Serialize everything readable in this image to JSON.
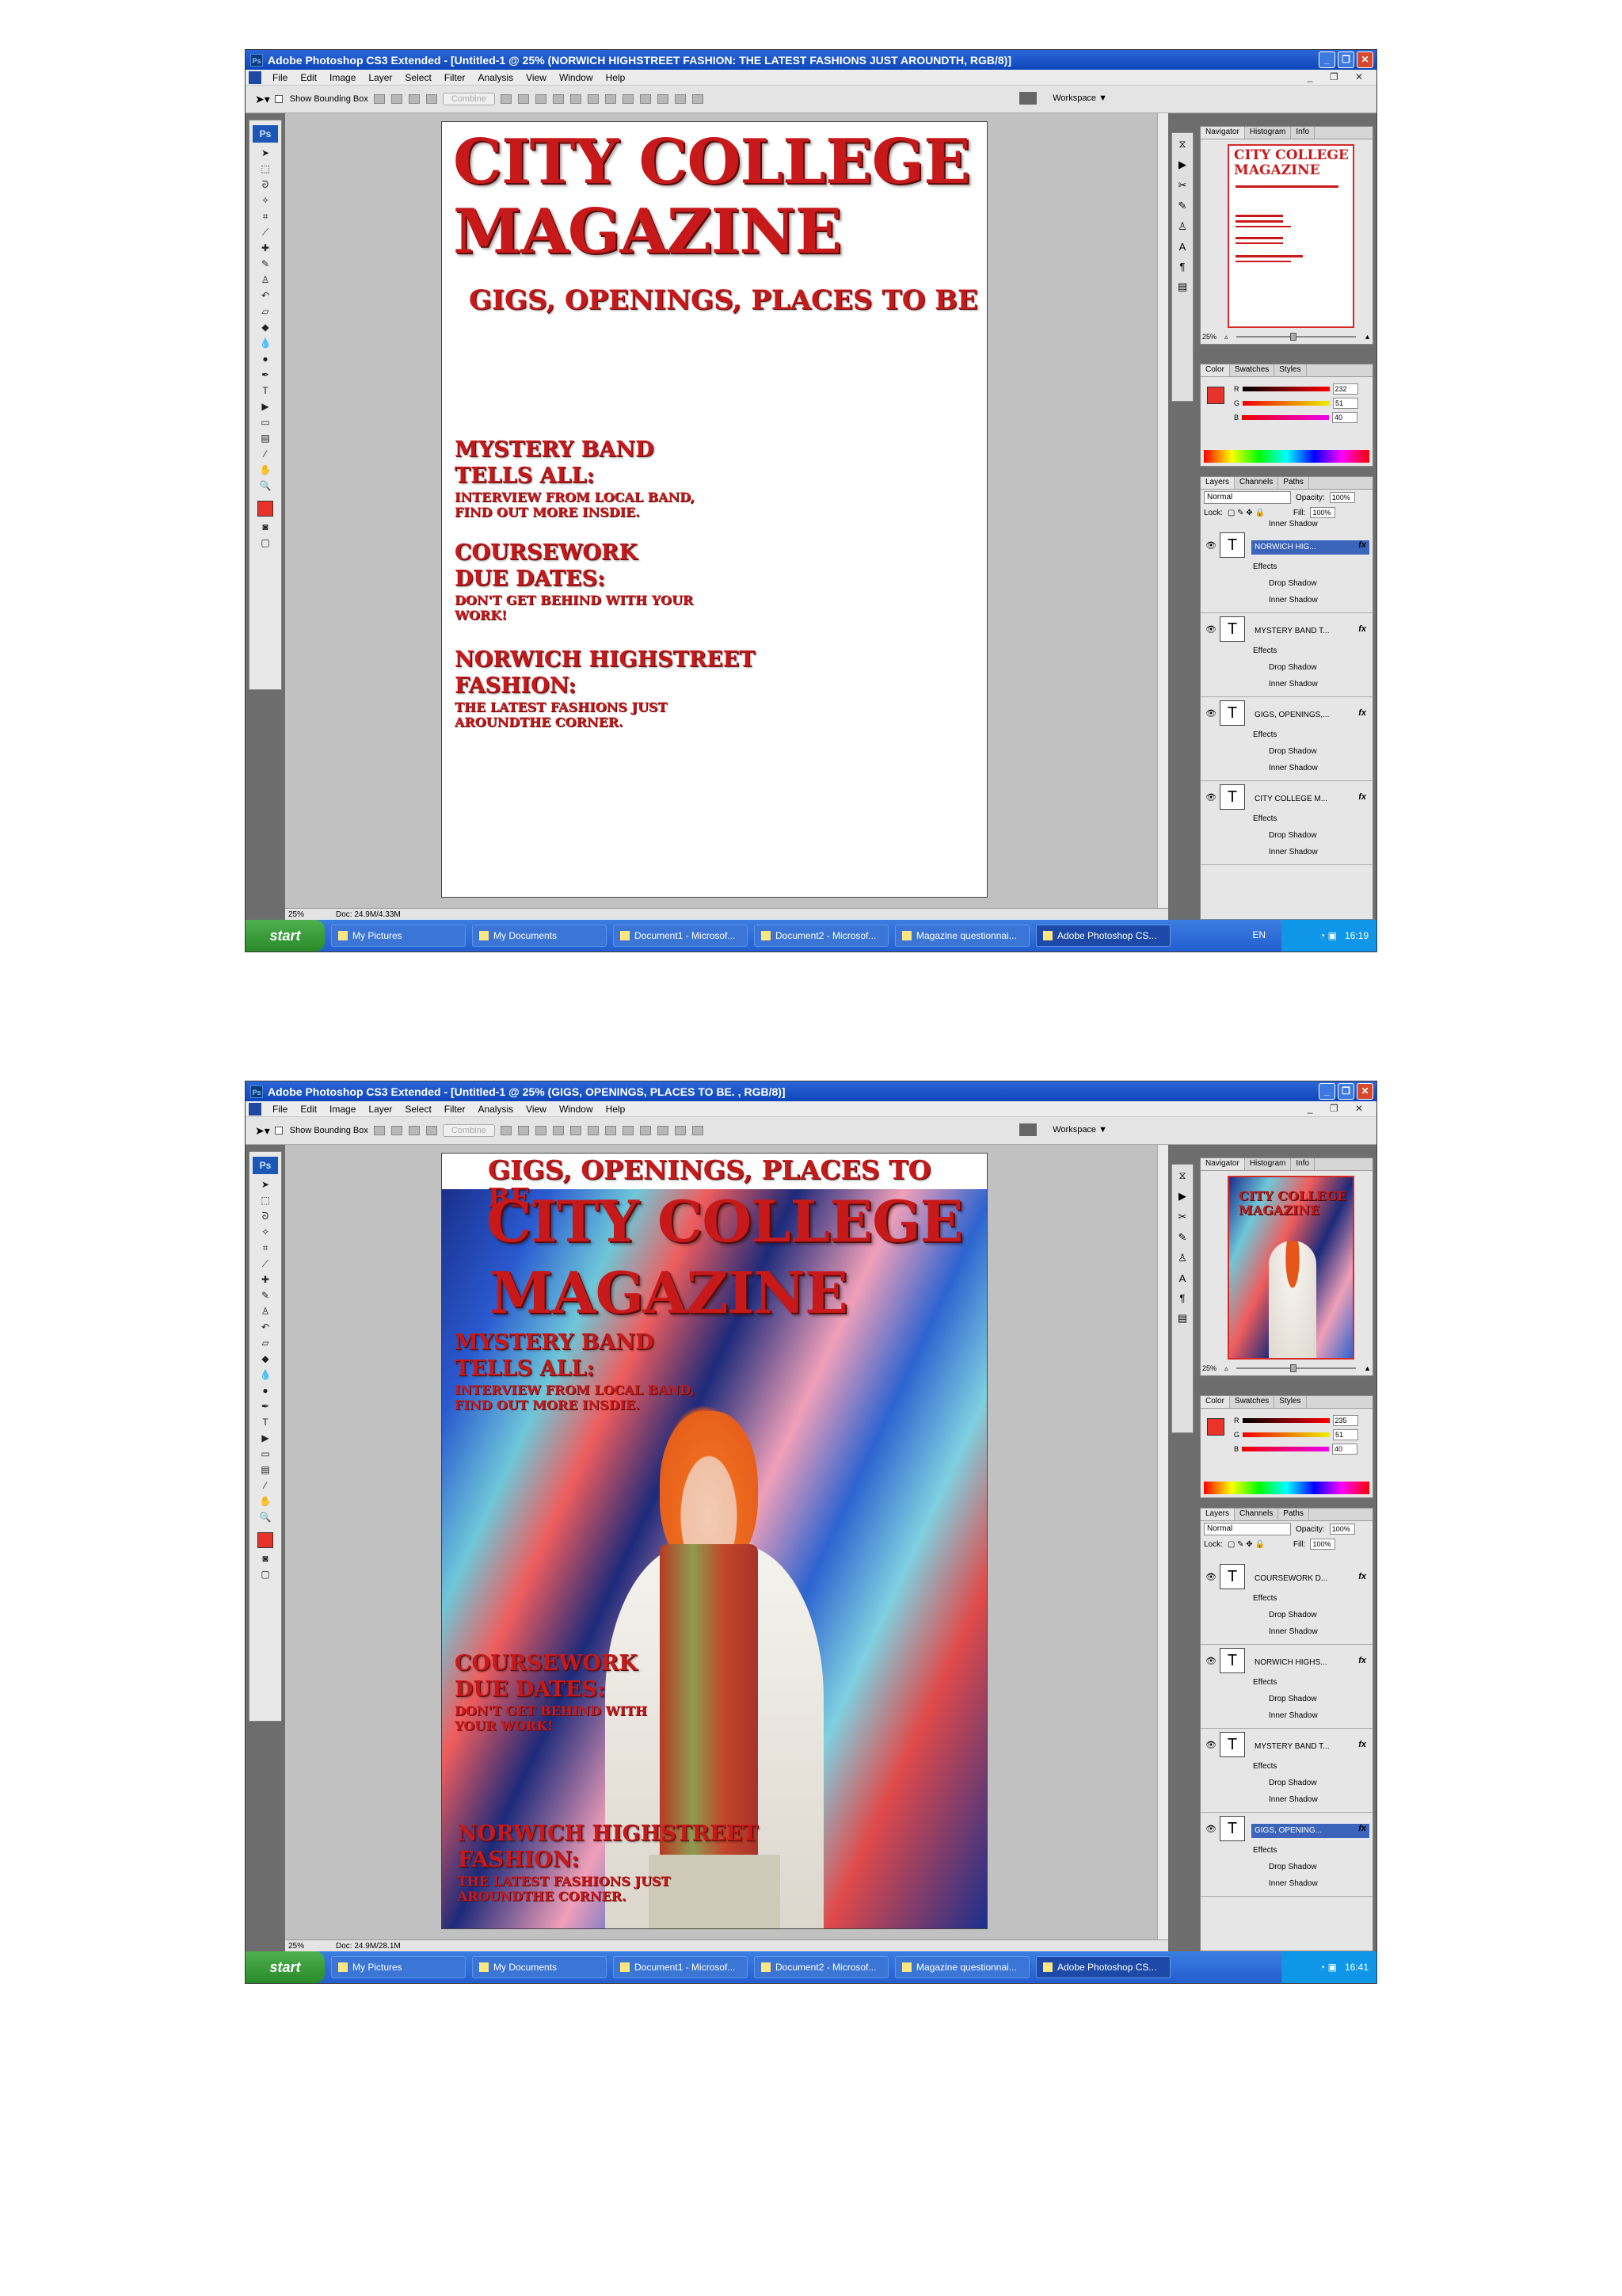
{
  "shots": [
    {
      "title": "Adobe Photoshop CS3 Extended - [Untitled-1 @ 25% (NORWICH HIGHSTREET  FASHION: THE LATEST FASHIONS JUST  AROUNDTH, RGB/8)]",
      "menu": [
        "File",
        "Edit",
        "Image",
        "Layer",
        "Select",
        "Filter",
        "Analysis",
        "View",
        "Window",
        "Help"
      ],
      "options": {
        "show_bounding_box": "Show Bounding Box",
        "combine": "Combine",
        "workspace": "Workspace ▼"
      },
      "status": {
        "zoom": "25%",
        "doc": "Doc: 24.9M/4.33M"
      },
      "canvas": {
        "title_line1": "CITY COLLEGE",
        "title_line2": "MAGAZINE",
        "tagline": "GIGS, OPENINGS, PLACES TO BE",
        "stories": [
          {
            "head1": "MYSTERY BAND",
            "head2": "TELLS ALL:",
            "sub1": "INTERVIEW FROM LOCAL BAND,",
            "sub2": "FIND OUT MORE INSDIE."
          },
          {
            "head1": "COURSEWORK",
            "head2": "DUE DATES:",
            "sub1": "DON'T GET BEHIND WITH YOUR",
            "sub2": "WORK!"
          },
          {
            "head1": "NORWICH HIGHSTREET",
            "head2": "FASHION:",
            "sub1": "THE LATEST FASHIONS JUST",
            "sub2": "AROUNDTHE CORNER."
          }
        ]
      },
      "navigator": {
        "tabs": [
          "Navigator",
          "Histogram",
          "Info"
        ],
        "zoom": "25%"
      },
      "color": {
        "tabs": [
          "Color",
          "Swatches",
          "Styles"
        ],
        "r": "232",
        "g": "51",
        "b": "40",
        "fg": "#e8332a"
      },
      "layers_panel": {
        "tabs": [
          "Layers",
          "Channels",
          "Paths"
        ],
        "blend": "Normal",
        "opacity_label": "Opacity:",
        "opacity": "100%",
        "lock_label": "Lock:",
        "fill_label": "Fill:",
        "fill": "100%",
        "top_partial": "Inner Shadow",
        "layers": [
          {
            "name": "NORWICH HIG...",
            "selected": true,
            "effects": "Effects",
            "e1": "Drop Shadow",
            "e2": "Inner Shadow"
          },
          {
            "name": "MYSTERY BAND  T...",
            "selected": false,
            "effects": "Effects",
            "e1": "Drop Shadow",
            "e2": "Inner Shadow"
          },
          {
            "name": "GIGS, OPENINGS,...",
            "selected": false,
            "effects": "Effects",
            "e1": "Drop Shadow",
            "e2": "Inner Shadow"
          },
          {
            "name": "CITY COLLEGE M...",
            "selected": false,
            "effects": "Effects",
            "e1": "Drop Shadow",
            "e2": "Inner Shadow"
          }
        ]
      },
      "taskbar": {
        "start": "start",
        "items": [
          "My Pictures",
          "My Documents",
          "Document1 - Microsof...",
          "Document2 - Microsof...",
          "Magazine questionnai...",
          "Adobe Photoshop CS..."
        ],
        "lang": "EN",
        "time": "16:19"
      }
    },
    {
      "title": "Adobe Photoshop CS3 Extended - [Untitled-1 @ 25% (GIGS, OPENINGS, PLACES TO BE. , RGB/8)]",
      "menu": [
        "File",
        "Edit",
        "Image",
        "Layer",
        "Select",
        "Filter",
        "Analysis",
        "View",
        "Window",
        "Help"
      ],
      "options": {
        "show_bounding_box": "Show Bounding Box",
        "combine": "Combine",
        "workspace": "Workspace ▼"
      },
      "status": {
        "zoom": "25%",
        "doc": "Doc: 24.9M/28.1M"
      },
      "canvas": {
        "tagline": "GIGS, OPENINGS, PLACES TO BE.",
        "title_line1": "CITY COLLEGE",
        "title_line2": "MAGAZINE",
        "stories": [
          {
            "head1": "MYSTERY BAND",
            "head2": "TELLS ALL:",
            "sub1": "INTERVIEW FROM LOCAL BAND,",
            "sub2": "FIND OUT MORE INSDIE."
          },
          {
            "head1": "COURSEWORK",
            "head2": "DUE DATES:",
            "sub1": "DON'T GET BEHIND WITH",
            "sub2": "YOUR WORK!"
          },
          {
            "head1": "NORWICH HIGHSTREET",
            "head2": "FASHION:",
            "sub1": "THE LATEST FASHIONS JUST",
            "sub2": "AROUNDTHE CORNER."
          }
        ]
      },
      "navigator": {
        "tabs": [
          "Navigator",
          "Histogram",
          "Info"
        ],
        "zoom": "25%"
      },
      "color": {
        "tabs": [
          "Color",
          "Swatches",
          "Styles"
        ],
        "r": "235",
        "g": "51",
        "b": "40",
        "fg": "#eb3328"
      },
      "layers_panel": {
        "tabs": [
          "Layers",
          "Channels",
          "Paths"
        ],
        "blend": "Normal",
        "opacity_label": "Opacity:",
        "opacity": "100%",
        "lock_label": "Lock:",
        "fill_label": "Fill:",
        "fill": "100%",
        "top_partial": "",
        "layers": [
          {
            "name": "COURSEWORK  D...",
            "selected": false,
            "effects": "Effects",
            "e1": "Drop Shadow",
            "e2": "Inner Shadow"
          },
          {
            "name": "NORWICH HIGHS...",
            "selected": false,
            "effects": "Effects",
            "e1": "Drop Shadow",
            "e2": "Inner Shadow"
          },
          {
            "name": "MYSTERY BAND  T...",
            "selected": false,
            "effects": "Effects",
            "e1": "Drop Shadow",
            "e2": "Inner Shadow"
          },
          {
            "name": "GIGS, OPENING...",
            "selected": true,
            "effects": "Effects",
            "e1": "Drop Shadow",
            "e2": "Inner Shadow"
          }
        ]
      },
      "taskbar": {
        "start": "start",
        "items": [
          "My Pictures",
          "My Documents",
          "Document1 - Microsof...",
          "Document2 - Microsof...",
          "Magazine questionnai...",
          "Adobe Photoshop CS..."
        ],
        "lang": "",
        "time": "16:41"
      }
    }
  ]
}
